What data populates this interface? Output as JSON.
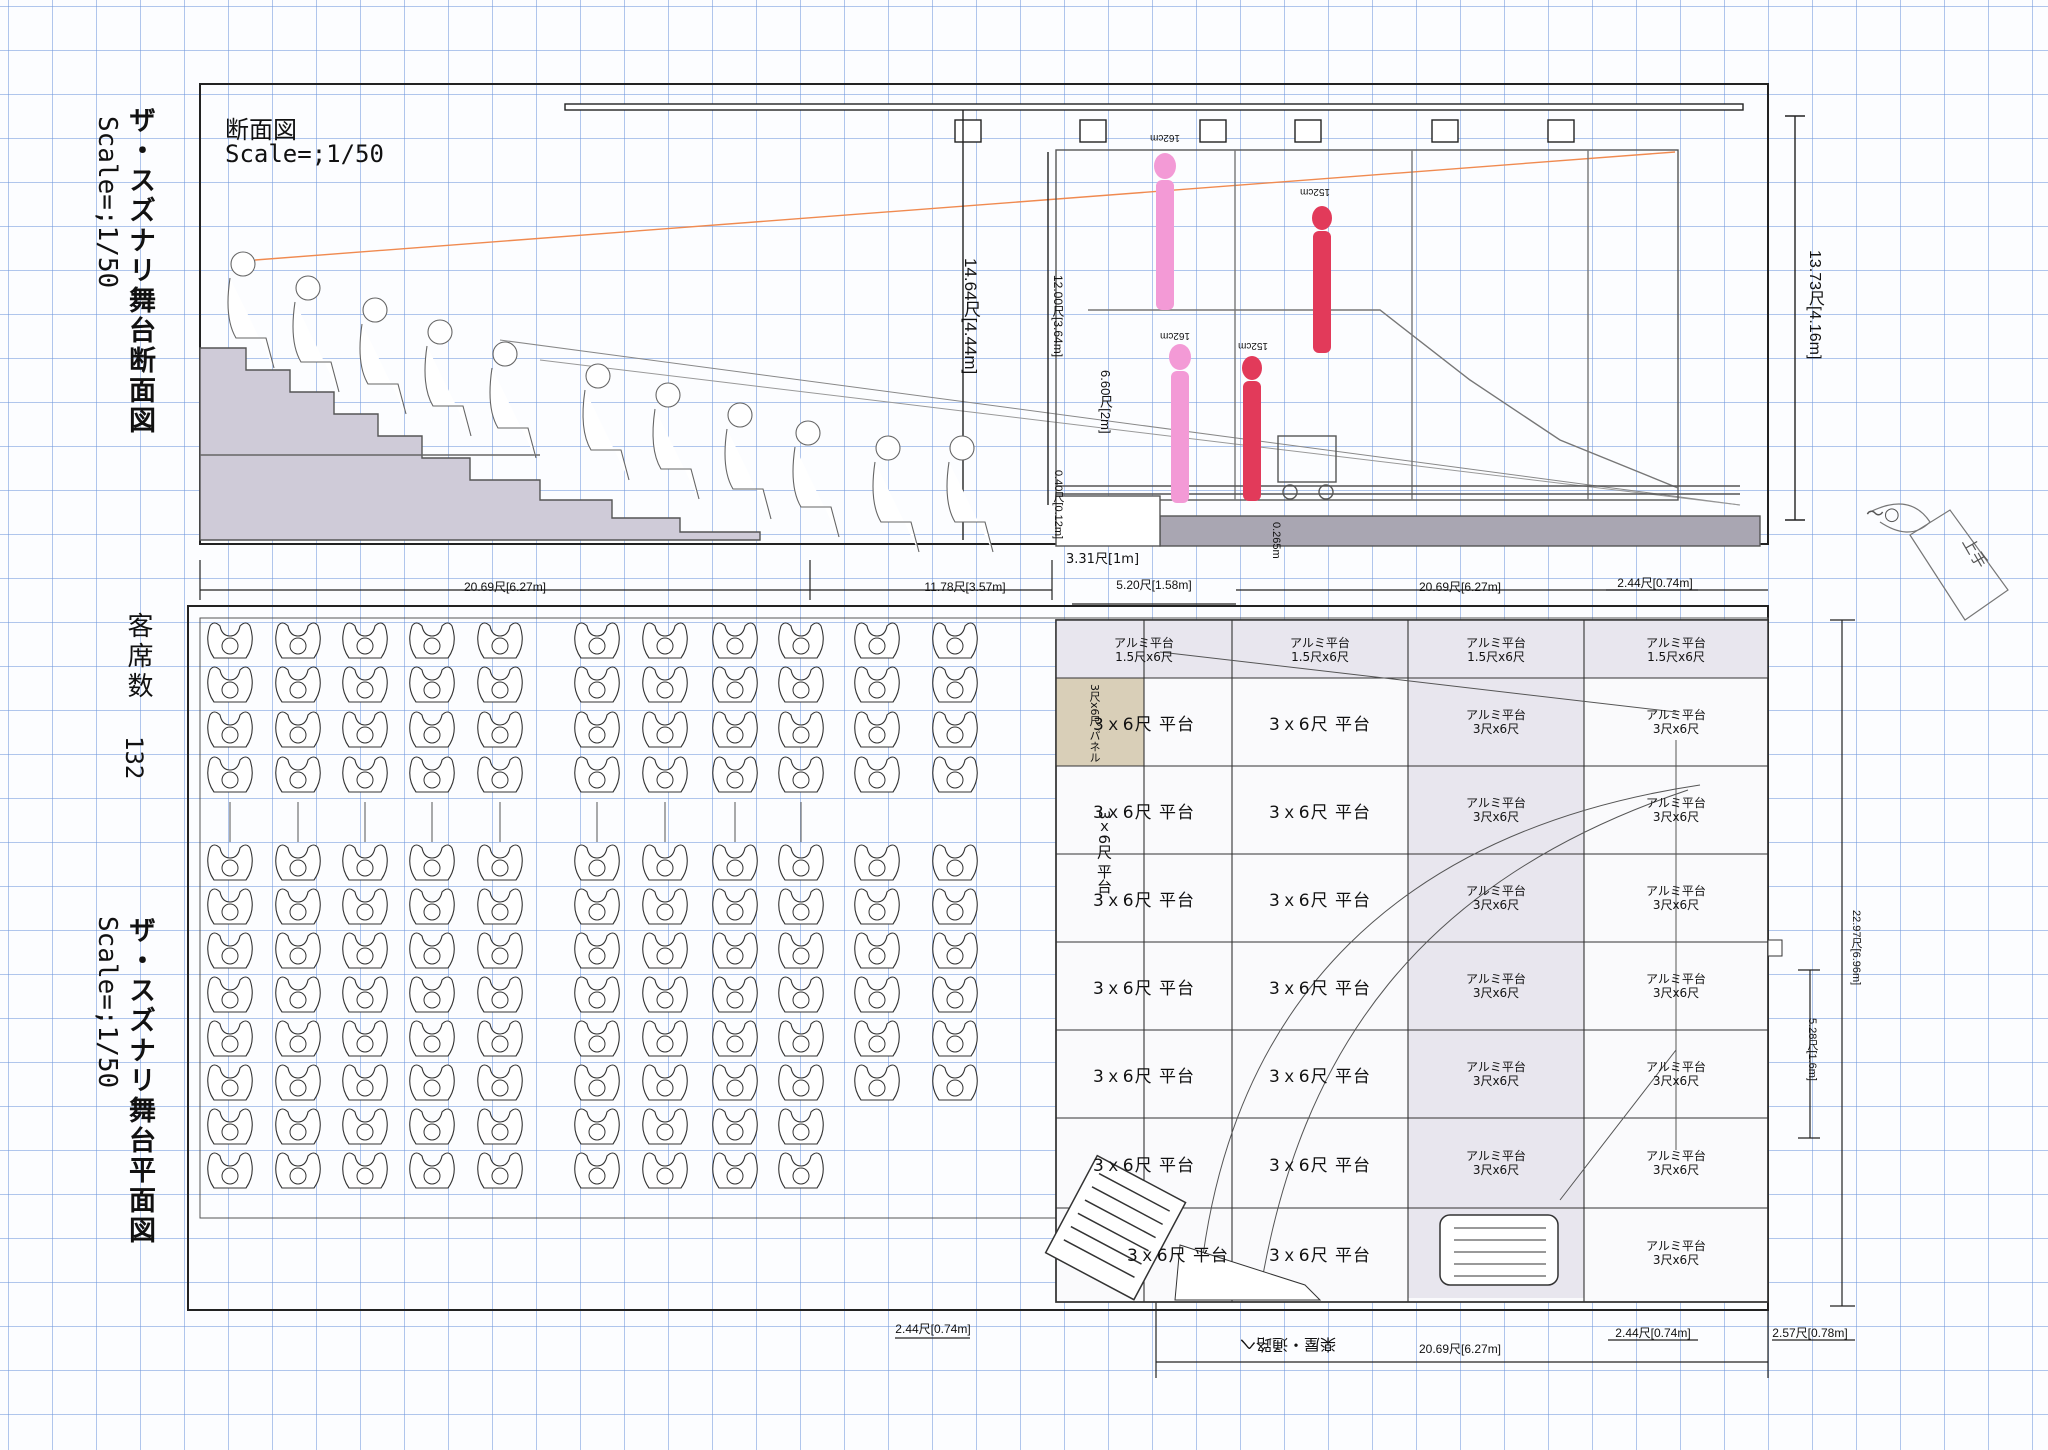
{
  "titles": {
    "section_title": "ザ・スズナリ舞台断面図",
    "plan_title": "ザ・スズナリ舞台平面図",
    "scale_text": "Scale=;1/50",
    "seat_count_label": "客席数",
    "seat_count_value": "132"
  },
  "section": {
    "label": "断面図",
    "scale": "Scale=;1/50",
    "dims": {
      "total_height": "13.73尺[4.16m]",
      "proscenium_height": "14.64尺[4.44m]",
      "stage_upper_height": "12.00尺[3.64m]",
      "platform_height": "6.60尺[2m]",
      "stage_edge_height": "0.40尺[0.12m]",
      "front_gap": "3.31尺[1m]",
      "floor_step": "0.265m"
    },
    "figures": [
      {
        "name": "162cm",
        "color": "#f39ad6"
      },
      {
        "name": "152cm",
        "color": "#e23a5a"
      },
      {
        "name": "162cm",
        "color": "#f39ad6"
      },
      {
        "name": "152cm",
        "color": "#e23a5a"
      }
    ]
  },
  "plan": {
    "dims_top": {
      "seating_width": "20.69尺[6.27m]",
      "front_rows_width": "11.78尺[3.57m]",
      "stage_front": "5.20尺[1.58m]",
      "stage_width": "20.69尺[6.27m]",
      "door_top": "2.44尺[0.74m]"
    },
    "dims_bottom": {
      "door_left": "2.44尺[0.74m]",
      "stage_width": "20.69尺[6.27m]",
      "door_right": "2.44尺[0.74m]",
      "offset": "2.57尺[0.78m]",
      "backstage": "楽屋・通路へ"
    },
    "dims_right": {
      "depth": "22.97尺[6.96m]",
      "door": "5.28尺[1.6m]"
    },
    "top_row_label_line1": "アルミ平台",
    "top_row_label_line2": "1.5尺x6尺",
    "platform_label": "3ｘ6尺 平台",
    "alu_line1": "アルミ平台",
    "alu_line2": "3尺x6尺",
    "corner_note": "3尺x6尺 パネル",
    "side_rotated_label": "3ｘ6尺 平台"
  },
  "margin_sketch": {
    "note1": "〜○",
    "note2": "上手"
  },
  "colors": {
    "stage_gray": "#e8e6ee",
    "seat_gray": "#cfcbd8",
    "dark_gray": "#a9a6b2",
    "pink": "#f39ad6",
    "red": "#e23a5a",
    "grid_blue": "#7098dc",
    "orange_line": "#f08a50"
  }
}
